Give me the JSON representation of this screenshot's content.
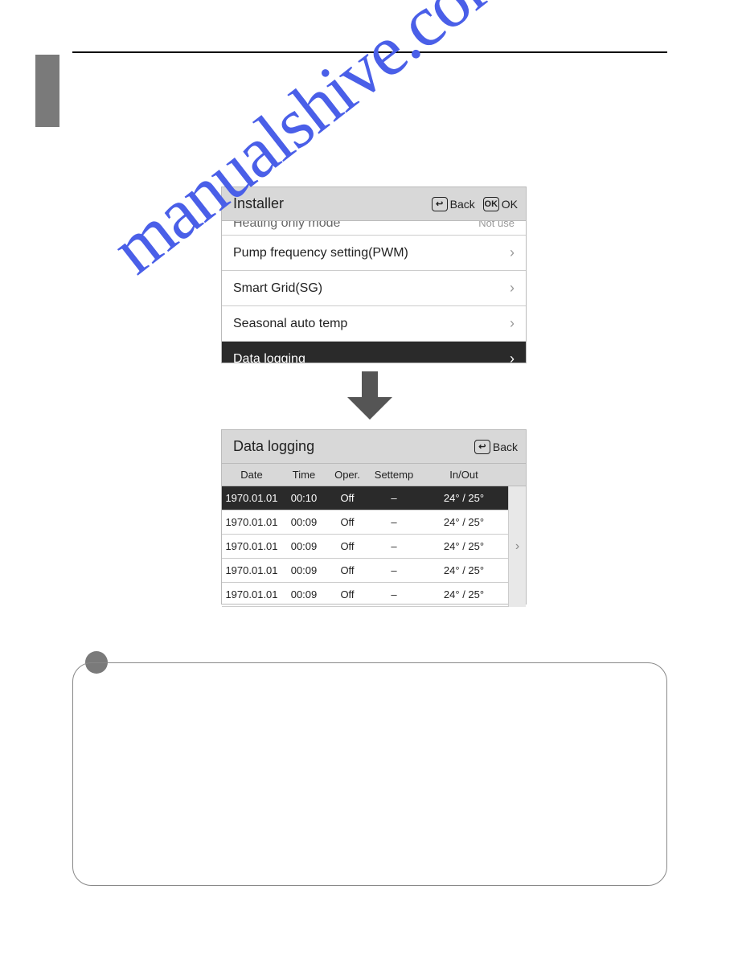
{
  "watermark_text": "manualshive.com",
  "installer": {
    "title": "Installer",
    "back_label": "Back",
    "ok_label": "OK",
    "cut_row": {
      "label": "Heating only mode",
      "right": "Not use"
    },
    "items": [
      {
        "label": "Pump frequency setting(PWM)"
      },
      {
        "label": "Smart Grid(SG)"
      },
      {
        "label": "Seasonal auto temp"
      },
      {
        "label": "Data logging",
        "selected": true
      }
    ]
  },
  "datalogging": {
    "title": "Data logging",
    "back_label": "Back",
    "headers": {
      "date": "Date",
      "time": "Time",
      "oper": "Oper.",
      "settemp": "Settemp",
      "inout": "In/Out"
    },
    "rows": [
      {
        "date": "1970.01.01",
        "time": "00:10",
        "oper": "Off",
        "settemp": "–",
        "inout": "24° / 25°",
        "selected": true
      },
      {
        "date": "1970.01.01",
        "time": "00:09",
        "oper": "Off",
        "settemp": "–",
        "inout": "24° / 25°"
      },
      {
        "date": "1970.01.01",
        "time": "00:09",
        "oper": "Off",
        "settemp": "–",
        "inout": "24° / 25°"
      },
      {
        "date": "1970.01.01",
        "time": "00:09",
        "oper": "Off",
        "settemp": "–",
        "inout": "24° / 25°"
      },
      {
        "date": "1970.01.01",
        "time": "00:09",
        "oper": "Off",
        "settemp": "–",
        "inout": "24° / 25°"
      }
    ]
  }
}
